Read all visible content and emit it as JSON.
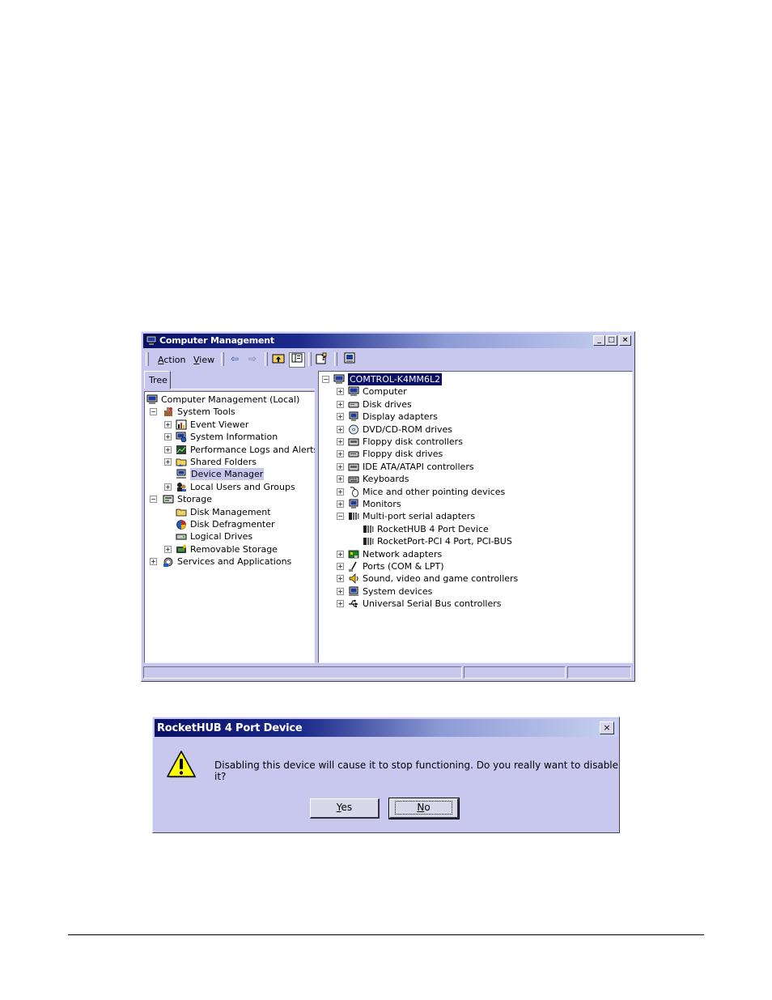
{
  "window": {
    "title": "Computer Management",
    "min_label": "_",
    "max_label": "□",
    "close_label": "×",
    "menu": [
      {
        "label_u": "A",
        "label_rest": "ction"
      },
      {
        "label_u": "V",
        "label_rest": "iew"
      }
    ],
    "tab_label": "Tree"
  },
  "left_tree": [
    {
      "label": "Computer Management (Local)",
      "icon": "computer-icon",
      "expander": ""
    },
    {
      "label": "System Tools",
      "icon": "tools-icon",
      "expander": "−"
    },
    {
      "label": "Event Viewer",
      "icon": "event-viewer-icon",
      "expander": "+"
    },
    {
      "label": "System Information",
      "icon": "system-info-icon",
      "expander": "+"
    },
    {
      "label": "Performance Logs and Alerts",
      "icon": "performance-icon",
      "expander": "+"
    },
    {
      "label": "Shared Folders",
      "icon": "shared-folder-icon",
      "expander": "+"
    },
    {
      "label": "Device Manager",
      "icon": "device-manager-icon",
      "expander": ""
    },
    {
      "label": "Local Users and Groups",
      "icon": "users-icon",
      "expander": "+"
    },
    {
      "label": "Storage",
      "icon": "storage-icon",
      "expander": "−"
    },
    {
      "label": "Disk Management",
      "icon": "folder-icon",
      "expander": ""
    },
    {
      "label": "Disk Defragmenter",
      "icon": "defrag-icon",
      "expander": ""
    },
    {
      "label": "Logical Drives",
      "icon": "drive-icon",
      "expander": ""
    },
    {
      "label": "Removable Storage",
      "icon": "removable-icon",
      "expander": "+"
    },
    {
      "label": "Services and Applications",
      "icon": "services-icon",
      "expander": "+"
    }
  ],
  "right_tree": [
    {
      "label": "COMTROL-K4MM6L2",
      "icon": "computer-icon",
      "expander": "−"
    },
    {
      "label": "Computer",
      "icon": "computer-icon",
      "expander": "+"
    },
    {
      "label": "Disk drives",
      "icon": "disk-icon",
      "expander": "+"
    },
    {
      "label": "Display adapters",
      "icon": "display-icon",
      "expander": "+"
    },
    {
      "label": "DVD/CD-ROM drives",
      "icon": "cdrom-icon",
      "expander": "+"
    },
    {
      "label": "Floppy disk controllers",
      "icon": "floppy-controller-icon",
      "expander": "+"
    },
    {
      "label": "Floppy disk drives",
      "icon": "floppy-icon",
      "expander": "+"
    },
    {
      "label": "IDE ATA/ATAPI controllers",
      "icon": "ide-icon",
      "expander": "+"
    },
    {
      "label": "Keyboards",
      "icon": "keyboard-icon",
      "expander": "+"
    },
    {
      "label": "Mice and other pointing devices",
      "icon": "mouse-icon",
      "expander": "+"
    },
    {
      "label": "Monitors",
      "icon": "monitor-icon",
      "expander": "+"
    },
    {
      "label": "Multi-port serial adapters",
      "icon": "serial-adapter-icon",
      "expander": "−"
    },
    {
      "label": "RocketHUB 4 Port Device",
      "icon": "serial-adapter-icon",
      "expander": ""
    },
    {
      "label": "RocketPort-PCI 4 Port, PCI-BUS",
      "icon": "serial-adapter-icon",
      "expander": ""
    },
    {
      "label": "Network adapters",
      "icon": "network-icon",
      "expander": "+"
    },
    {
      "label": "Ports (COM & LPT)",
      "icon": "port-icon",
      "expander": "+"
    },
    {
      "label": "Sound, video and game controllers",
      "icon": "sound-icon",
      "expander": "+"
    },
    {
      "label": "System devices",
      "icon": "system-devices-icon",
      "expander": "+"
    },
    {
      "label": "Universal Serial Bus controllers",
      "icon": "usb-icon",
      "expander": "+"
    }
  ],
  "dialog": {
    "title": "RocketHUB 4 Port Device",
    "close_label": "×",
    "message": "Disabling this device will cause it to stop functioning. Do you really want to disable it?",
    "yes_u": "Y",
    "yes_rest": "es",
    "no_u": "N",
    "no_rest": "o"
  },
  "colors": {
    "title_active": "#0a1064",
    "window_face": "#c8c8ef",
    "selection": "#0a1064"
  }
}
